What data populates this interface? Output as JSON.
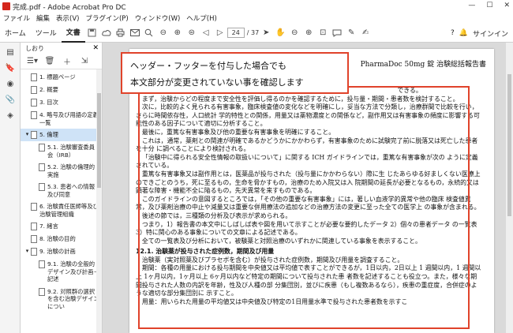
{
  "window": {
    "title": "完成.pdf - Adobe Acrobat Pro DC",
    "controls": [
      "—",
      "☐",
      "✕"
    ]
  },
  "menu": [
    "ファイル",
    "編集",
    "表示(V)",
    "ブラグイン(P)",
    "ウィンドウ(W)",
    "ヘルプ(H)"
  ],
  "tabs": [
    "ホーム",
    "ツール",
    "文書"
  ],
  "toolbar": {
    "page_current": "24",
    "page_total": "/ 37",
    "signin": "サインイン"
  },
  "bookmarks": {
    "header": "しおり",
    "items": [
      {
        "label": "1. 標題ページ",
        "toggle": "",
        "indent": 0
      },
      {
        "label": "2. 概要",
        "toggle": "",
        "indent": 0
      },
      {
        "label": "3. 目次",
        "toggle": "",
        "indent": 0
      },
      {
        "label": "4. 略号及び用語の定義一覧",
        "toggle": "",
        "indent": 0
      },
      {
        "label": "5. 倫理",
        "toggle": "▾",
        "indent": 0,
        "selected": true
      },
      {
        "label": "5.1. 治験審査委員会（IRB）",
        "toggle": "",
        "indent": 1
      },
      {
        "label": "5.2. 治験の倫理的実施",
        "toggle": "",
        "indent": 1
      },
      {
        "label": "5.3. 患者への情報及び同意",
        "toggle": "",
        "indent": 1
      },
      {
        "label": "6. 治験責任医師等及び治験管理組織",
        "toggle": "",
        "indent": 0
      },
      {
        "label": "7. 緒言",
        "toggle": "",
        "indent": 0
      },
      {
        "label": "8. 治験の目的",
        "toggle": "",
        "indent": 0
      },
      {
        "label": "9. 治験の計画",
        "toggle": "▾",
        "indent": 0
      },
      {
        "label": "9.1. 治験の全般的デザイン及び計画－記述",
        "toggle": "",
        "indent": 1
      },
      {
        "label": "9.2. 対照群の選択を含む治験デザインについ",
        "toggle": "",
        "indent": 1
      }
    ]
  },
  "document": {
    "header_right": "PharmaDoc 50mg 錠  治験総括報告書",
    "paragraphs": [
      "　　　　　　　　　　　　　　　　　　　　　　　　　　　　　　　　　　　　　　　　　　できる。",
      "まず，治験からどの程度まで安全性を評価し得るのかを確認するために，投与量・期間・患者数を検討すること。",
      "次に，比較的よく見られる有害事象，臨床検査値の変化などを明確にし，妥当な方法で分類し，治療群間で比較を行い，さらに時間依存性，人口統計 学的特性との関係，用量又は薬物濃度との関係など，副作用又は有害事象の頻度に影響する可能性のある因子について適切に分析すること。",
      "最後に，重篤な有害事象及び他の重要な有害事象を明確にすること。",
      "これは，通常，薬剤との関連が明確であるかどうかにかかわらず，有害事象のために試験完了前に脱落又は死亡した患者を十分 に調べることにより検討される。",
      "「治験中に得られる安全性情報の取扱いについて」に関する ICH ガイドラインでは，重篤な有害事象が次の ように定義されている。",
      "重篤な有害事象又は副作用とは，医薬品が投与された（投与量にかかわらない）際に生 じたあらゆる好ましくない医療上のできごとのうち，死に至るもの，生命を脅かすもの，治療のため入院又は入 院期間の延長が必要となるもの，永続的又は顕著な障害・機能不全に陥るもの，先天異常を来すものである。",
      "このガイドラインの意図するところでは，「その他の重要な有害事象」には，著しい血液学的異常や他の臨床 検査値異常，及び薬剤治療の中止や減量又は重要な併用療法の追加などの治療方法の変更に至った全ての医学上 の事象が含まれる。",
      "後述の節では，三種類の分析及び表示が求められる。",
      "つまり，1）報告書の本文中にしばしば表や図を用いて示すことが必要な要約したデータ 2）個々の患者データ の一覧表 3）特に関心のある事象についての文章による記述である。",
      "全ての一覧表及び分析において，被験薬と対照治療のいずれかに関連している事象を表示すること。"
    ],
    "section_title": "12.1. 治験薬が投与された症例数，期間及び用量",
    "section_paragraphs": [
      "治験薬（実対照薬及びプラセボを含む）が投与された症例数，期間及び用量を調査すること。",
      "期間：各種の用量における投与期間を中央値又は平均値で表すことができるが，1日以内，2日以上 1 週間以内，1 週間以上 1ヶ月以内，1ヶ月以上 6ヶ月以内など特定の期間について投与された患 者数を記述することも役立つ。また，様々な期間投与された人数の内訳を年齢，性及び人種の部 分集団別，並びに疾患（もし複数あるなら），疾患の重症度，合併症のような適切な部分集団別に 示すこと。",
      "用量：用いられた用量の平均値又は中央値及び特定の1日用量水準で投与された患者数を示すこ"
    ]
  },
  "callout": {
    "line1": "ヘッダー・フッターを付与した場合でも",
    "line2": "本文部分が変更されていない事を確認します"
  },
  "colors": {
    "accent_red": "#e0432b",
    "selection": "#cfe3f7"
  }
}
